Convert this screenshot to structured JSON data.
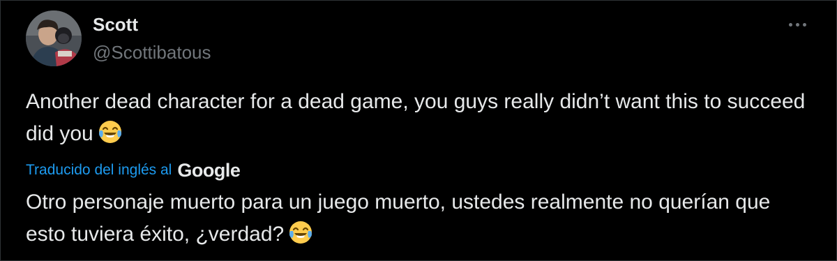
{
  "author": {
    "display_name": "Scott",
    "handle": "@Scottibatous"
  },
  "tweet": {
    "text": "Another dead character for a dead game, you guys really didn’t want this to succeed did you",
    "emoji": "face-with-tears-of-joy"
  },
  "translation": {
    "label": "Traducido del inglés al",
    "provider": "Google",
    "text": "Otro personaje muerto para un juego muerto, ustedes realmente no querían que esto tuviera éxito, ¿verdad?",
    "emoji": "face-with-tears-of-joy"
  },
  "icons": {
    "more": "more-horizontal-icon"
  },
  "colors": {
    "background": "#000000",
    "text": "#e7e9ea",
    "secondary": "#71767b",
    "link": "#1d9bf0"
  }
}
